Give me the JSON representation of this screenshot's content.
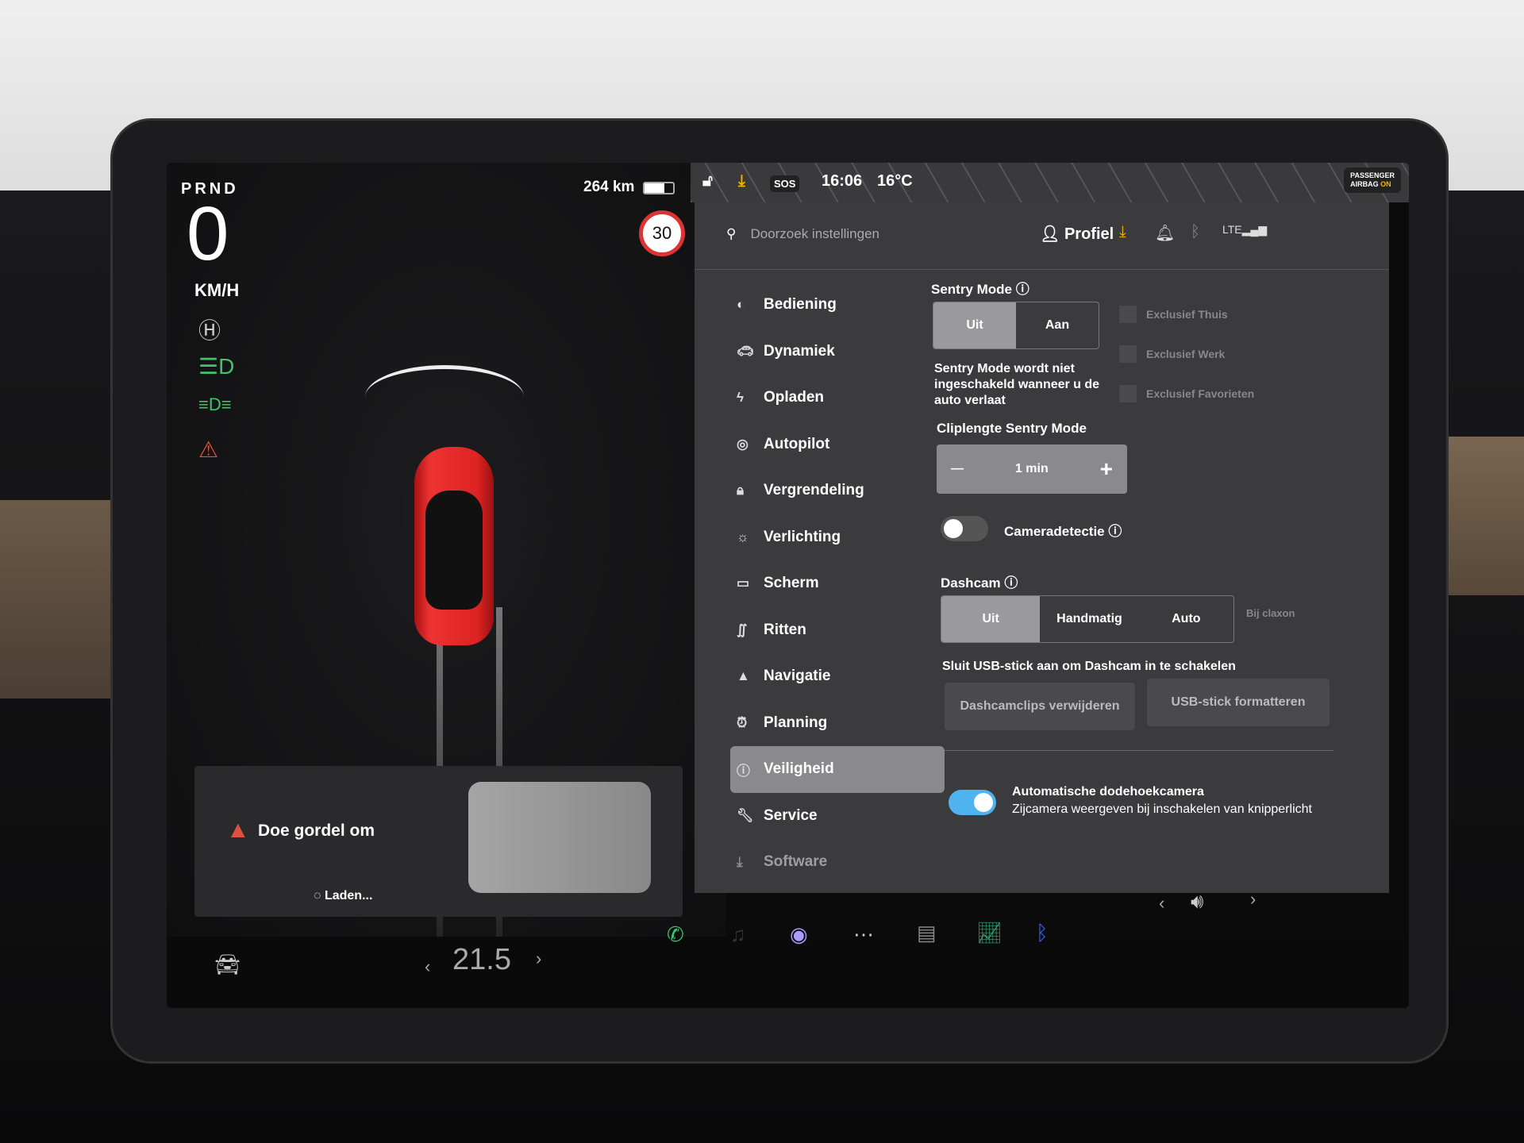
{
  "drive": {
    "gear": "PRND",
    "speed": "0",
    "speed_unit": "KM/H",
    "range": "264 km",
    "battery_level": 0.7,
    "speed_limit": "30",
    "alert": "Doe gordel om",
    "loading": "Laden..."
  },
  "status": {
    "time": "16:06",
    "temperature": "16°C",
    "sos": "SOS",
    "airbag_line1": "PASSENGER",
    "airbag_line2": "AIRBAG",
    "airbag_state": "ON"
  },
  "topbar": {
    "search_placeholder": "Doorzoek instellingen",
    "profile": "Profiel"
  },
  "menu": [
    {
      "label": "Bediening",
      "icon": "toggle-icon"
    },
    {
      "label": "Dynamiek",
      "icon": "car-icon"
    },
    {
      "label": "Opladen",
      "icon": "bolt-icon"
    },
    {
      "label": "Autopilot",
      "icon": "steering-wheel-icon"
    },
    {
      "label": "Vergrendeling",
      "icon": "lock-icon"
    },
    {
      "label": "Verlichting",
      "icon": "sun-icon"
    },
    {
      "label": "Scherm",
      "icon": "display-icon"
    },
    {
      "label": "Ritten",
      "icon": "trips-icon"
    },
    {
      "label": "Navigatie",
      "icon": "navigation-icon"
    },
    {
      "label": "Planning",
      "icon": "clock-icon"
    },
    {
      "label": "Veiligheid",
      "icon": "info-icon",
      "active": true
    },
    {
      "label": "Service",
      "icon": "wrench-icon"
    },
    {
      "label": "Software",
      "icon": "download-icon"
    }
  ],
  "sentry": {
    "title": "Sentry Mode",
    "options": [
      "Uit",
      "Aan"
    ],
    "selected": "Uit",
    "description": "Sentry Mode wordt niet ingeschakeld wanneer u de auto verlaat",
    "exclusions": [
      "Exclusief Thuis",
      "Exclusief Werk",
      "Exclusief Favorieten"
    ]
  },
  "clip": {
    "title": "Cliplengte Sentry Mode",
    "value": "1 min",
    "minus": "—",
    "plus": "+"
  },
  "camera_detection": {
    "label": "Cameradetectie",
    "enabled": false
  },
  "dashcam": {
    "title": "Dashcam",
    "options": [
      "Uit",
      "Handmatig",
      "Auto",
      "Bij claxon"
    ],
    "selected": "Uit",
    "usb_notice": "Sluit USB-stick aan om Dashcam in te schakelen",
    "delete_clips": "Dashcamclips verwijderen",
    "format_usb": "USB-stick formatteren"
  },
  "blindspot": {
    "label": "Automatische dodehoekcamera",
    "description": "Zijcamera weergeven bij inschakelen van knipperlicht",
    "enabled": true
  },
  "climate": {
    "temperature": "21.5"
  },
  "colors": {
    "accent": "#4fb3f0",
    "alert": "#e05040",
    "download": "#f5b400",
    "green": "#3ec46d"
  }
}
